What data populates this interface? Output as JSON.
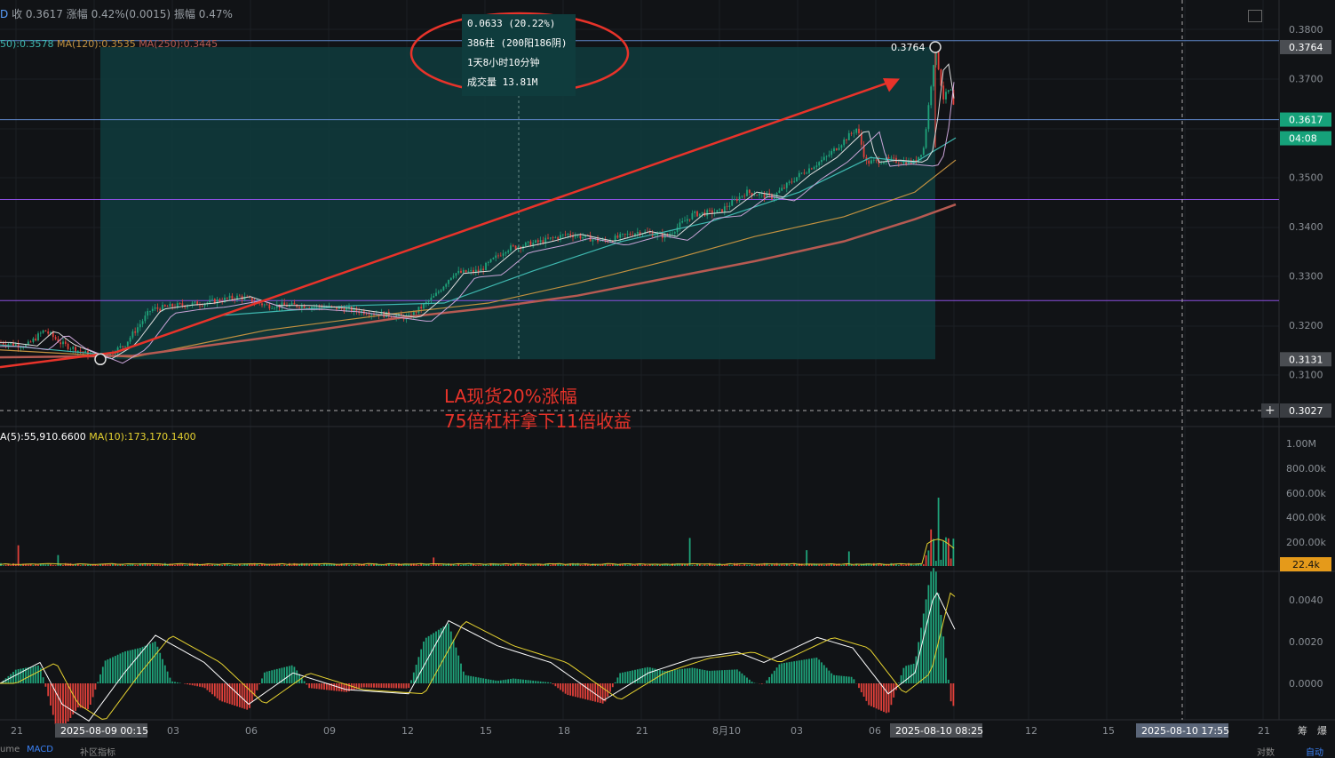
{
  "header": {
    "close_label": "收",
    "close_value": "0.3617",
    "change_label": "涨幅",
    "change_value": "0.42%(0.0015)",
    "amp_label": "振幅",
    "amp_value": "0.47%"
  },
  "ma_legend": {
    "ma60": "50):0.3578",
    "ma120": "MA(120):0.3535",
    "ma250": "MA(250):0.3445"
  },
  "vol_legend": {
    "ma5": "A(5):55,910.6600",
    "ma10": "MA(10):173,170.1400"
  },
  "measure_box": {
    "line1": "0.0633 (20.22%)",
    "line2": "386柱 (200阳186阴)",
    "line3": "1天8小时10分钟",
    "line4": "成交量 13.81M"
  },
  "annotation": {
    "line1": "LA现货20%涨幅",
    "line2": "75倍杠杆拿下11倍收益"
  },
  "bottom_tabs": {
    "macd": "MACD",
    "indicator": "补区指标",
    "left": "ume",
    "right1": "对数",
    "right2": "自动"
  },
  "colors": {
    "background": "#111316",
    "measure_fill": "#0f3c3d",
    "up": "#1fa37a",
    "down": "#e0403a",
    "arrow": "#e8332a",
    "ma_white": "#ffffff",
    "ma_cyan": "#3fb8b0",
    "ma_orange": "#c29140",
    "ma_brown": "#b65a52",
    "level_purple": "#8b4fe0",
    "level_blue": "#5f86c8",
    "current_price": "#16a27a",
    "vol_ma_yellow": "#e6d230"
  },
  "chart_data": {
    "type": "candlestick",
    "price_axis": {
      "ticks": [
        "0.3800",
        "0.3700",
        "0.3500",
        "0.3400",
        "0.3300",
        "0.3200",
        "0.3100"
      ],
      "range": [
        0.3084,
        0.3832
      ]
    },
    "price_labels": {
      "high_marker": "0.3764",
      "high_tag": "0.3764",
      "current": "0.3617",
      "countdown": "04:08",
      "low_tag": "0.3131",
      "crosshair": "0.3027"
    },
    "volume_axis": {
      "ticks": [
        "1.00M",
        "800.00k",
        "600.00k",
        "400.00k",
        "200.00k"
      ],
      "current": "22.4k"
    },
    "macd_axis": {
      "ticks": [
        "0.0040",
        "0.0020",
        "0.0000"
      ]
    },
    "time_axis": {
      "ticks": [
        "21",
        "03",
        "06",
        "09",
        "12",
        "15",
        "18",
        "21",
        "8月10",
        "03",
        "06",
        "12",
        "15",
        "21"
      ],
      "highlight_start": "2025-08-09 00:15",
      "highlight_end": "2025-08-10 08:25",
      "crosshair_time": "2025-08-10 17:55",
      "right_labels": [
        "筹",
        "爆"
      ]
    },
    "key_points": {
      "low": 0.3131,
      "high": 0.3764,
      "current": 0.3617,
      "purple_levels": [
        0.3455,
        0.325
      ],
      "blue_levels": [
        0.3777,
        0.3617
      ]
    },
    "price_path": [
      [
        0,
        0.3165
      ],
      [
        30,
        0.3158
      ],
      [
        50,
        0.319
      ],
      [
        70,
        0.3162
      ],
      [
        113,
        0.3131
      ],
      [
        140,
        0.316
      ],
      [
        170,
        0.3232
      ],
      [
        200,
        0.324
      ],
      [
        230,
        0.3245
      ],
      [
        270,
        0.3258
      ],
      [
        300,
        0.324
      ],
      [
        340,
        0.324
      ],
      [
        380,
        0.3235
      ],
      [
        420,
        0.3225
      ],
      [
        460,
        0.3215
      ],
      [
        490,
        0.326
      ],
      [
        510,
        0.3305
      ],
      [
        540,
        0.331
      ],
      [
        570,
        0.3355
      ],
      [
        610,
        0.337
      ],
      [
        640,
        0.3385
      ],
      [
        680,
        0.337
      ],
      [
        720,
        0.339
      ],
      [
        750,
        0.338
      ],
      [
        780,
        0.3425
      ],
      [
        810,
        0.343
      ],
      [
        840,
        0.347
      ],
      [
        870,
        0.346
      ],
      [
        900,
        0.3505
      ],
      [
        930,
        0.354
      ],
      [
        965,
        0.36
      ],
      [
        975,
        0.353
      ],
      [
        1000,
        0.3535
      ],
      [
        1030,
        0.353
      ],
      [
        1040,
        0.356
      ],
      [
        1053,
        0.3764
      ],
      [
        1062,
        0.366
      ],
      [
        1070,
        0.368
      ],
      [
        1076,
        0.3617
      ]
    ],
    "series": [
      {
        "name": "MA(60)",
        "points": [
          [
            0,
            0.316
          ],
          [
            120,
            0.314
          ],
          [
            250,
            0.322
          ],
          [
            400,
            0.324
          ],
          [
            500,
            0.3245
          ],
          [
            600,
            0.331
          ],
          [
            700,
            0.337
          ],
          [
            800,
            0.341
          ],
          [
            900,
            0.347
          ],
          [
            980,
            0.354
          ],
          [
            1030,
            0.353
          ],
          [
            1076,
            0.358
          ]
        ]
      },
      {
        "name": "MA(120)",
        "points": [
          [
            0,
            0.315
          ],
          [
            150,
            0.3135
          ],
          [
            300,
            0.319
          ],
          [
            450,
            0.3225
          ],
          [
            550,
            0.3245
          ],
          [
            650,
            0.3285
          ],
          [
            750,
            0.333
          ],
          [
            850,
            0.338
          ],
          [
            950,
            0.342
          ],
          [
            1030,
            0.347
          ],
          [
            1076,
            0.3535
          ]
        ]
      },
      {
        "name": "MA(250)",
        "points": [
          [
            0,
            0.3135
          ],
          [
            150,
            0.3138
          ],
          [
            300,
            0.3175
          ],
          [
            450,
            0.3215
          ],
          [
            550,
            0.3235
          ],
          [
            650,
            0.326
          ],
          [
            750,
            0.3295
          ],
          [
            850,
            0.333
          ],
          [
            950,
            0.337
          ],
          [
            1030,
            0.3415
          ],
          [
            1076,
            0.3445
          ]
        ]
      }
    ],
    "volume_spikes": [
      [
        20,
        170
      ],
      [
        65,
        90
      ],
      [
        489,
        70
      ],
      [
        776,
        230
      ],
      [
        907,
        130
      ],
      [
        957,
        120
      ],
      [
        1049,
        300
      ],
      [
        1056,
        560
      ]
    ],
    "macd_dif_path": [
      [
        0,
        0.0
      ],
      [
        45,
        0.001
      ],
      [
        70,
        -0.001
      ],
      [
        100,
        -0.0018
      ],
      [
        140,
        0.0005
      ],
      [
        175,
        0.0023
      ],
      [
        230,
        0.001
      ],
      [
        280,
        -0.001
      ],
      [
        330,
        0.0005
      ],
      [
        390,
        -0.0003
      ],
      [
        460,
        -0.0005
      ],
      [
        505,
        0.003
      ],
      [
        560,
        0.0018
      ],
      [
        620,
        0.001
      ],
      [
        680,
        -0.0008
      ],
      [
        730,
        0.0005
      ],
      [
        780,
        0.0012
      ],
      [
        830,
        0.0015
      ],
      [
        860,
        0.001
      ],
      [
        920,
        0.0022
      ],
      [
        960,
        0.0017
      ],
      [
        1000,
        -0.0005
      ],
      [
        1030,
        0.0005
      ],
      [
        1053,
        0.0045
      ],
      [
        1076,
        0.0025
      ]
    ]
  }
}
